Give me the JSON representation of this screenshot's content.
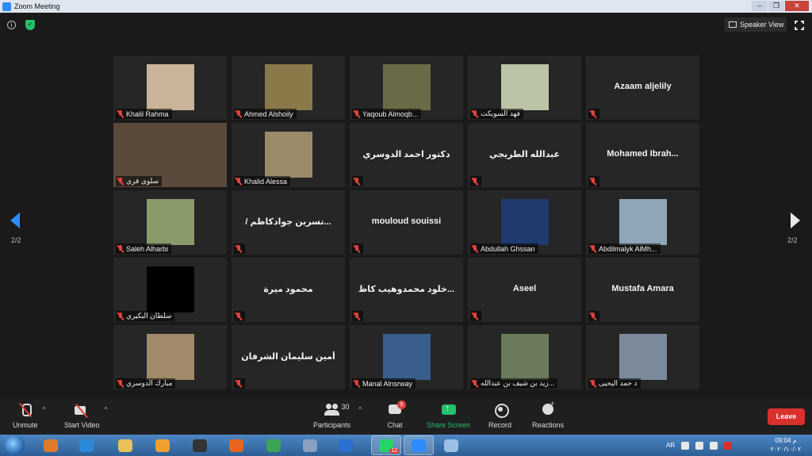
{
  "window": {
    "title": "Zoom Meeting",
    "controls": [
      "–",
      "❐",
      "✕"
    ]
  },
  "header": {
    "speaker_view_label": "Speaker View"
  },
  "pager": {
    "left": "2/2",
    "right": "2/2"
  },
  "participants": [
    {
      "name": "Khalil Rahma",
      "type": "photo",
      "color": "#c9b49a"
    },
    {
      "name": "Ahmed Alshoily",
      "type": "photo",
      "color": "#8a7a4a"
    },
    {
      "name": "Yaqoub Almoqb...",
      "type": "photo",
      "color": "#6b6a48"
    },
    {
      "name": "فهد السويكت",
      "type": "photo",
      "color": "#bcc4a8"
    },
    {
      "name": "Azaam aljelily",
      "type": "name"
    },
    {
      "name": "سلوى فري",
      "type": "bigphoto",
      "color": "#5a4a3c"
    },
    {
      "name": "Khalid Alessa",
      "type": "photo",
      "color": "#9a8a6a"
    },
    {
      "name": "دكتور احمد الدوسري",
      "type": "name"
    },
    {
      "name": "عبدالله الطريجي",
      "type": "name"
    },
    {
      "name": "Mohamed  Ibrah...",
      "type": "name"
    },
    {
      "name": "Saleh Alharbi",
      "type": "photo",
      "color": "#8a9a6a"
    },
    {
      "name": "/ نسرين جوادكاظم...",
      "type": "name"
    },
    {
      "name": "mouloud souissi",
      "type": "name"
    },
    {
      "name": "Abdullah Ghssan",
      "type": "photo",
      "color": "#1f3b6e"
    },
    {
      "name": "Abdilmalyk AlMh...",
      "type": "photo",
      "color": "#8fa6b8"
    },
    {
      "name": "سلطان البكيري",
      "type": "photo",
      "color": "#000000"
    },
    {
      "name": "محمود ميرة",
      "type": "name"
    },
    {
      "name": "خلود محمدوهيب كاظ...",
      "type": "name"
    },
    {
      "name": "Aseel",
      "type": "name"
    },
    {
      "name": "Mustafa Amara",
      "type": "name"
    },
    {
      "name": "مبارك الدوسري",
      "type": "photo",
      "color": "#a08a6a"
    },
    {
      "name": "أمين سليمان الشرفان",
      "type": "name"
    },
    {
      "name": "Manal Alnsrway",
      "type": "photo",
      "color": "#3a5e8c"
    },
    {
      "name": "زيد بن شيف بن عبدالله...",
      "type": "photo",
      "color": "#6a7a5a"
    },
    {
      "name": "د حمد اليحيى",
      "type": "photo",
      "color": "#7a8a9a"
    }
  ],
  "toolbar": {
    "unmute": "Unmute",
    "start_video": "Start Video",
    "participants": "Participants",
    "participants_count": "30",
    "chat": "Chat",
    "chat_badge": "5",
    "share_screen": "Share Screen",
    "record": "Record",
    "reactions": "Reactions",
    "leave": "Leave"
  },
  "taskbar": {
    "language": "AR",
    "time": "09:04 م",
    "date": "٢٠٢٠/١٠/٠٢",
    "apps": [
      {
        "name": "media-player",
        "color": "#e07a2a"
      },
      {
        "name": "internet-explorer",
        "color": "#2a8ad9"
      },
      {
        "name": "folder",
        "color": "#e8c25a"
      },
      {
        "name": "orange-app",
        "color": "#f0a030"
      },
      {
        "name": "film-app",
        "color": "#333333"
      },
      {
        "name": "firefox",
        "color": "#e8641e"
      },
      {
        "name": "chrome",
        "color": "#3aa655"
      },
      {
        "name": "bird-app",
        "color": "#8aa0c0"
      },
      {
        "name": "blue-app",
        "color": "#2d6fd0"
      },
      {
        "name": "whatsapp",
        "color": "#25d366"
      },
      {
        "name": "zoom",
        "color": "#2d8cff"
      },
      {
        "name": "paint",
        "color": "#9ac0e8"
      }
    ],
    "whatsapp_badge": "12"
  },
  "colors": {
    "accent": "#2d8cff",
    "leave": "#d9302c",
    "share": "#23c16b",
    "muted": "#e0423a"
  }
}
